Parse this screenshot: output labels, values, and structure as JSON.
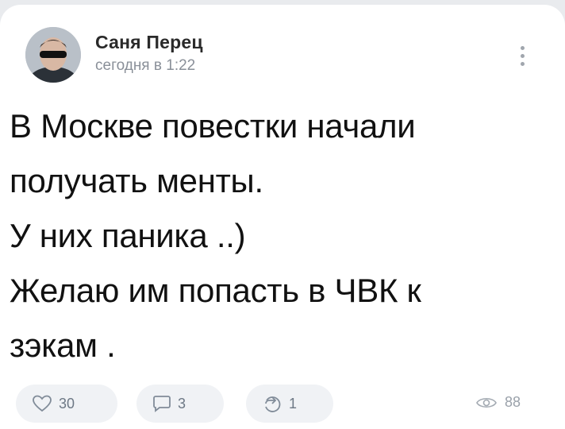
{
  "post": {
    "author": "Саня Перец",
    "time": "сегодня в 1:22",
    "text_lines": [
      "В Москве  повестки начали",
      "получать менты.",
      "У них паника ..)",
      "Желаю им попасть в ЧВК к",
      "зэкам ."
    ]
  },
  "actions": {
    "likes": "30",
    "comments": "3",
    "shares": "1",
    "views": "88"
  },
  "icons": {
    "menu": "more-vertical-icon",
    "like": "heart-icon",
    "comment": "comment-icon",
    "share": "share-icon",
    "views": "eye-icon"
  },
  "colors": {
    "background": "#e9ebee",
    "card": "#ffffff",
    "pill": "#f0f2f5",
    "icon": "#6d7885"
  }
}
